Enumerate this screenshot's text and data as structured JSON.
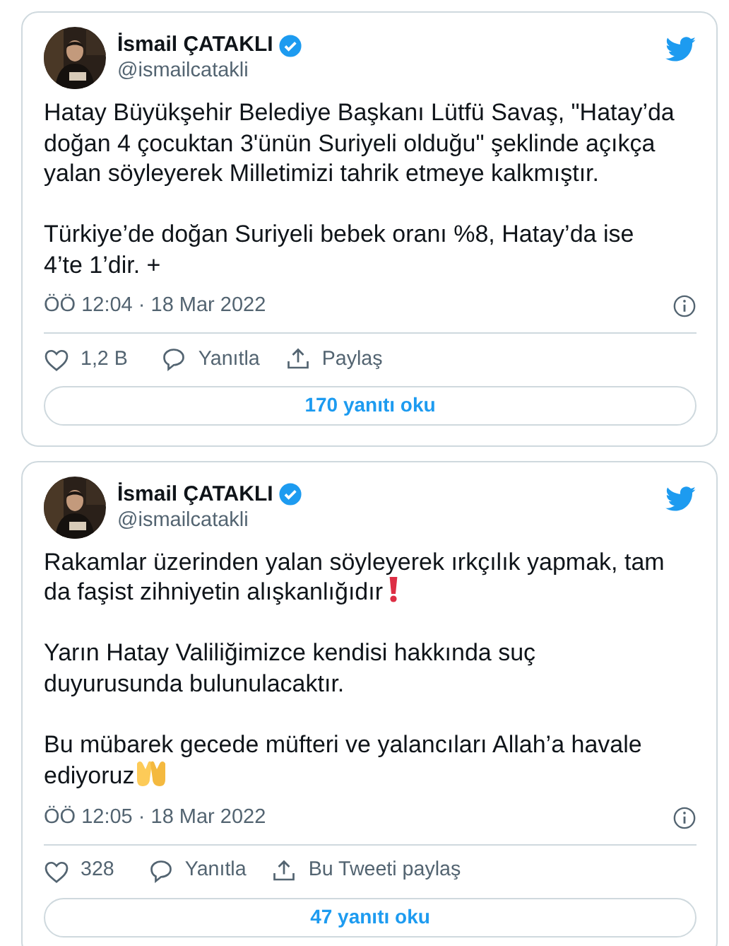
{
  "tweets": [
    {
      "author": {
        "name": "İsmail ÇATAKLI",
        "handle": "@ismailcatakli",
        "verified": true
      },
      "paragraphs": [
        {
          "text": "Hatay Büyükşehir Belediye Başkanı Lütfü Savaş, \"Hatay’da doğan 4 çocuktan 3'ünün Suriyeli olduğu\" şeklinde açıkça yalan söyleyerek Milletimizi tahrik etmeye kalkmıştır."
        },
        {
          "text": "Türkiye’de doğan Suriyeli bebek oranı %8, Hatay’da ise 4’te 1’dir. +"
        }
      ],
      "timestamp": "ÖÖ 12:04 · 18 Mar 2022",
      "likes": "1,2 B",
      "reply": "Yanıtla",
      "share": "Paylaş",
      "read_replies": "170 yanıtı oku"
    },
    {
      "author": {
        "name": "İsmail ÇATAKLI",
        "handle": "@ismailcatakli",
        "verified": true
      },
      "paragraphs": [
        {
          "text": "Rakamlar üzerinden yalan söyleyerek ırkçılık yapmak, tam da faşist zihniyetin alışkanlığıdır",
          "exclamation_mark": true
        },
        {
          "text": "Yarın Hatay Valiliğimizce kendisi hakkında suç duyurusunda bulunulacaktır."
        },
        {
          "text": "Bu mübarek gecede müfteri ve yalancıları Allah’a havale ediyoruz",
          "raised_palms": true
        }
      ],
      "timestamp": "ÖÖ 12:05 · 18 Mar 2022",
      "likes": "328",
      "reply": "Yanıtla",
      "share": "Bu Tweeti paylaş",
      "read_replies": "47 yanıtı oku"
    }
  ]
}
